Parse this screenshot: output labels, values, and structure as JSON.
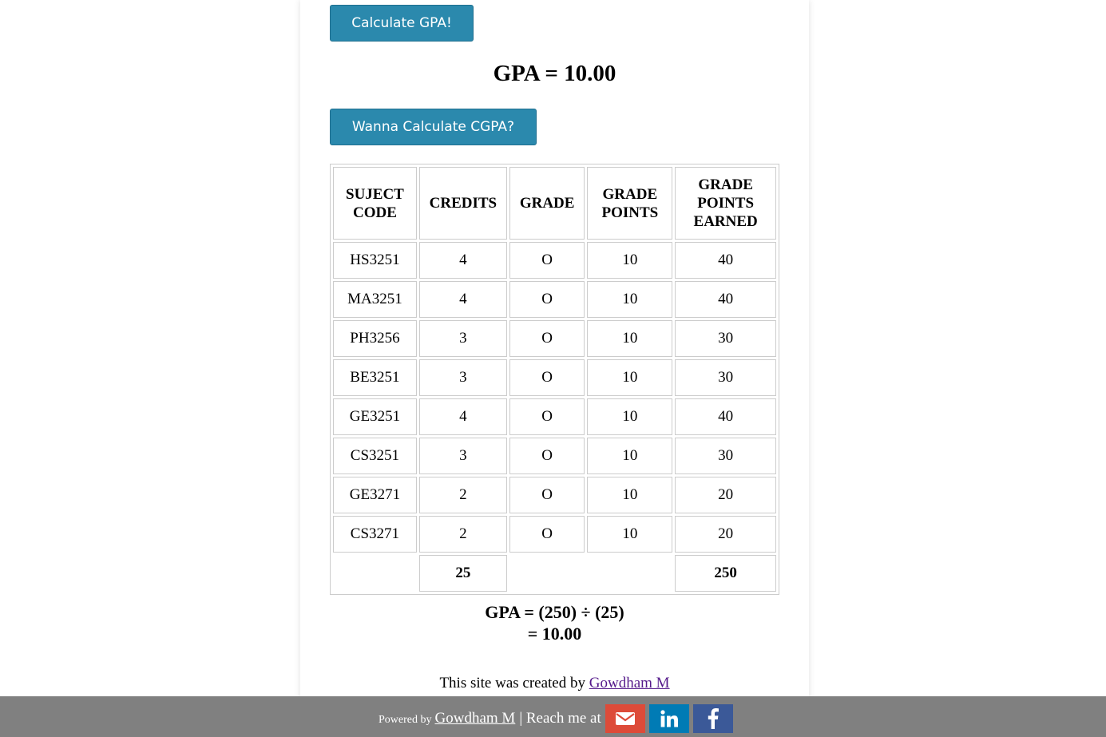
{
  "buttons": {
    "calculate_gpa": "Calculate GPA!",
    "calculate_cgpa": "Wanna Calculate CGPA?"
  },
  "result": {
    "gpa_text": "GPA = 10.00"
  },
  "table": {
    "headers": {
      "code_line1": "SUJECT",
      "code_line2": "CODE",
      "credits": "CREDITS",
      "grade": "GRADE",
      "gp_line1": "GRADE",
      "gp_line2": "POINTS",
      "gpe_line1": "GRADE",
      "gpe_line2": "POINTS",
      "gpe_line3": "EARNED"
    },
    "rows": [
      {
        "code": "HS3251",
        "credits": "4",
        "grade": "O",
        "points": "10",
        "earned": "40"
      },
      {
        "code": "MA3251",
        "credits": "4",
        "grade": "O",
        "points": "10",
        "earned": "40"
      },
      {
        "code": "PH3256",
        "credits": "3",
        "grade": "O",
        "points": "10",
        "earned": "30"
      },
      {
        "code": "BE3251",
        "credits": "3",
        "grade": "O",
        "points": "10",
        "earned": "30"
      },
      {
        "code": "GE3251",
        "credits": "4",
        "grade": "O",
        "points": "10",
        "earned": "40"
      },
      {
        "code": "CS3251",
        "credits": "3",
        "grade": "O",
        "points": "10",
        "earned": "30"
      },
      {
        "code": "GE3271",
        "credits": "2",
        "grade": "O",
        "points": "10",
        "earned": "20"
      },
      {
        "code": "CS3271",
        "credits": "2",
        "grade": "O",
        "points": "10",
        "earned": "20"
      }
    ],
    "totals": {
      "credits": "25",
      "earned": "250"
    }
  },
  "formula": {
    "line1": "GPA = (250) ÷ (25)",
    "line2": "= 10.00"
  },
  "credit_line": {
    "text": "This site was created by",
    "author_link": "Gowdham M"
  },
  "footer": {
    "powered_by": "Powered by",
    "author_link": "Gowdham M",
    "reach_text": "| Reach me at",
    "icons": [
      "envelope-icon",
      "linkedin-icon",
      "facebook-icon"
    ],
    "colors": {
      "bar": "#808080",
      "email": "#dd4b39",
      "linkedin": "#007bb5",
      "facebook": "#3b5998"
    }
  },
  "colors": {
    "button": "#2b89ad"
  }
}
